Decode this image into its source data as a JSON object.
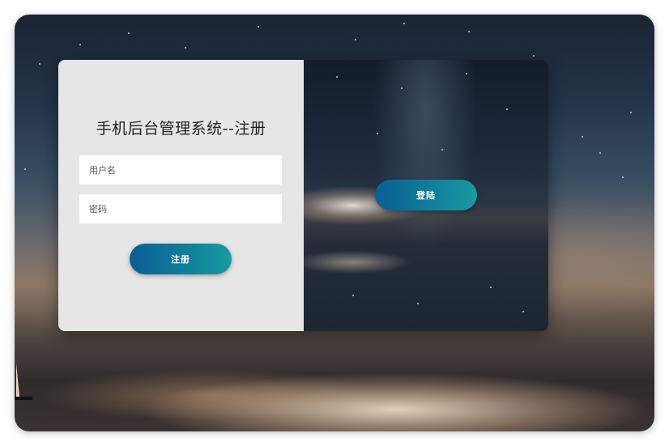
{
  "register_form": {
    "title": "手机后台管理系统--注册",
    "username_placeholder": "用户名",
    "password_placeholder": "密码",
    "username_value": "",
    "password_value": "",
    "register_button_label": "注册"
  },
  "side_panel": {
    "login_button_label": "登陆"
  },
  "colors": {
    "form_panel_background": "#e6e6e6",
    "button_gradient_start": "#0b5e94",
    "button_gradient_end": "#1a9aa0",
    "button_text": "#ffffff"
  }
}
